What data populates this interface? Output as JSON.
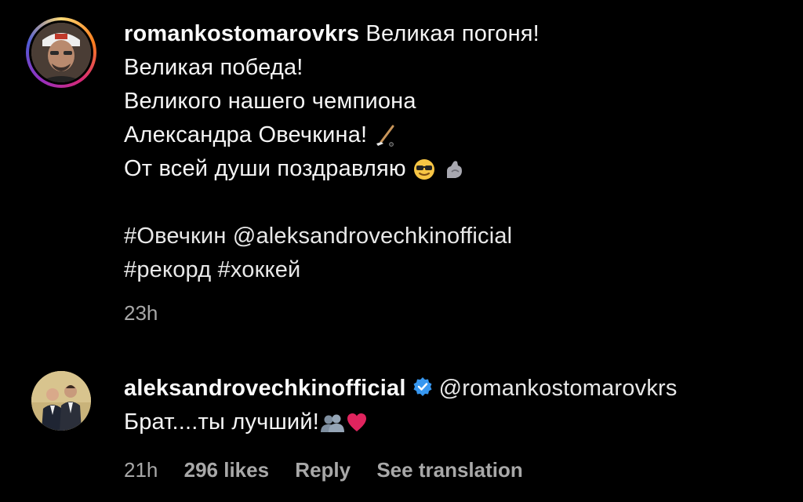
{
  "comment1": {
    "username": "romankostomarovkrs",
    "lines": [
      "Великая погоня!",
      "Великая победа!",
      "Великого нашего чемпиона",
      "Александра Овечкина!",
      "От всей души поздравляю"
    ],
    "hashtag_ovechkin": "#Овечкин",
    "mention_ovechkin": "@aleksandrovechkinofficial",
    "hashtag_record": "#рекорд",
    "hashtag_hockey": "#хоккей",
    "time": "23h",
    "icons": {
      "hockey": "hockey-stick-icon",
      "sunglasses": "sunglasses-face-icon",
      "muscle": "flexed-biceps-icon"
    }
  },
  "comment2": {
    "username": "aleksandrovechkinofficial",
    "mention": "@romankostomarovkrs",
    "text": "Брат....ты лучший!",
    "time": "21h",
    "likes": "296 likes",
    "reply_label": "Reply",
    "translation_label": "See translation",
    "icons": {
      "verified": "verified-badge-icon",
      "people": "busts-in-silhouette-icon",
      "heart": "red-heart-icon"
    }
  },
  "colors": {
    "background": "#000000",
    "text": "#f5f5f5",
    "secondary": "#a8a8a8",
    "verified": "#3797f0",
    "heart": "#e0245e"
  }
}
